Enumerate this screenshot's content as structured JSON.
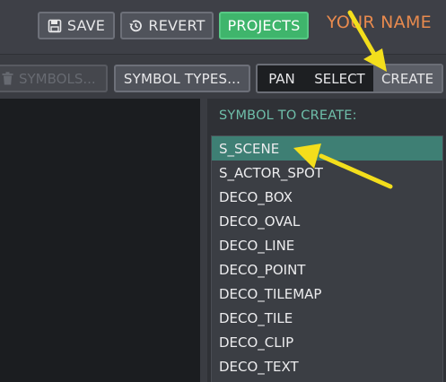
{
  "toolbar": {
    "save_label": "SAVE",
    "revert_label": "REVERT",
    "projects_label": "PROJECTS",
    "username": "YOUR NAME"
  },
  "subtoolbar": {
    "symbols_label": "SYMBOLS...",
    "symbol_types_label": "SYMBOL TYPES...",
    "modes": [
      "PAN",
      "SELECT",
      "CREATE"
    ],
    "active_mode": "CREATE"
  },
  "symbol_panel": {
    "header": "SYMBOL TO CREATE:",
    "items": [
      {
        "label": "S_SCENE"
      },
      {
        "label": "S_ACTOR_SPOT"
      },
      {
        "label": "DECO_BOX"
      },
      {
        "label": "DECO_OVAL"
      },
      {
        "label": "DECO_LINE"
      },
      {
        "label": "DECO_POINT"
      },
      {
        "label": "DECO_TILEMAP"
      },
      {
        "label": "DECO_TILE"
      },
      {
        "label": "DECO_CLIP"
      },
      {
        "label": "DECO_TEXT"
      }
    ],
    "selected_item": "S_SCENE"
  },
  "colors": {
    "projects_button": "#3fb56c",
    "username": "#e88a4e",
    "selected_row": "#3e7f74",
    "panel_header": "#6fbfaa",
    "annotation_arrow": "#f3de1c"
  },
  "icons": {
    "save": "floppy-disk-icon",
    "revert": "history-icon",
    "symbols": "trash-icon"
  }
}
